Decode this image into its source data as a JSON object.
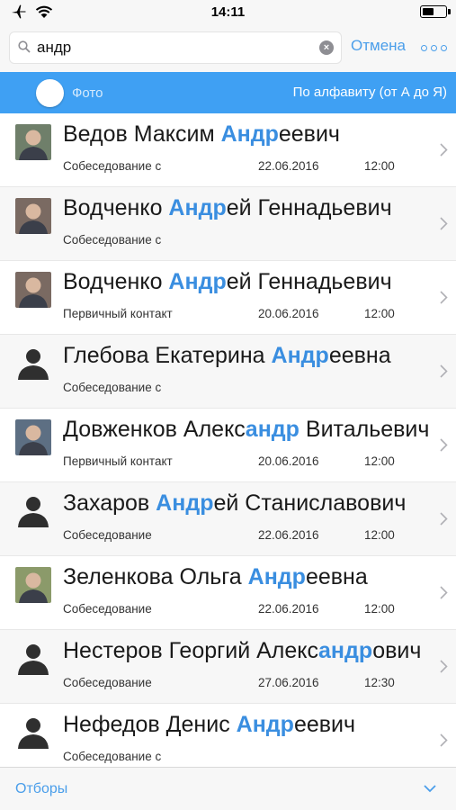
{
  "status_bar": {
    "time": "14:11",
    "icons": [
      "airplane-icon",
      "wifi-icon",
      "battery-icon"
    ]
  },
  "search": {
    "value": "андр",
    "placeholder": "",
    "cancel_label": "Отмена"
  },
  "filter_bar": {
    "photo_label": "Фото",
    "sort_label": "По алфавиту (от А до Я)"
  },
  "contacts": [
    {
      "name_pre": "Ведов Максим ",
      "name_hl": "Андр",
      "name_post": "еевич",
      "stage": "Собеседование с",
      "date": "22.06.2016",
      "time": "12:00",
      "avatar": "photo",
      "avatar_bg": "#6f7f6a"
    },
    {
      "name_pre": "Водченко ",
      "name_hl": "Андр",
      "name_post": "ей Геннадьевич",
      "stage": "Собеседование с",
      "date": "",
      "time": "",
      "avatar": "photo",
      "avatar_bg": "#7a6a62"
    },
    {
      "name_pre": "Водченко ",
      "name_hl": "Андр",
      "name_post": "ей Геннадьевич",
      "stage": "Первичный контакт",
      "date": "20.06.2016",
      "time": "12:00",
      "avatar": "photo",
      "avatar_bg": "#7a6a62"
    },
    {
      "name_pre": "Глебова Екатерина ",
      "name_hl": "Андр",
      "name_post": "еевна",
      "stage": "Собеседование с",
      "date": "",
      "time": "",
      "avatar": "silhouette",
      "avatar_bg": ""
    },
    {
      "name_pre": "Довженков Алекс",
      "name_hl": "андр",
      "name_post": " Витальевич",
      "stage": "Первичный контакт",
      "date": "20.06.2016",
      "time": "12:00",
      "avatar": "photo",
      "avatar_bg": "#5d6f83"
    },
    {
      "name_pre": "Захаров ",
      "name_hl": "Андр",
      "name_post": "ей Станиславович",
      "stage": "Собеседование",
      "date": "22.06.2016",
      "time": "12:00",
      "avatar": "silhouette",
      "avatar_bg": ""
    },
    {
      "name_pre": "Зеленкова Ольга ",
      "name_hl": "Андр",
      "name_post": "еевна",
      "stage": "Собеседование",
      "date": "22.06.2016",
      "time": "12:00",
      "avatar": "photo",
      "avatar_bg": "#8b9a6a"
    },
    {
      "name_pre": "Нестеров Георгий Алекс",
      "name_hl": "андр",
      "name_post": "ович",
      "stage": "Собеседование",
      "date": "27.06.2016",
      "time": "12:30",
      "avatar": "silhouette",
      "avatar_bg": ""
    },
    {
      "name_pre": "Нефедов Денис ",
      "name_hl": "Андр",
      "name_post": "еевич",
      "stage": "Собеседование с",
      "date": "",
      "time": "",
      "avatar": "silhouette",
      "avatar_bg": ""
    }
  ],
  "bottom_bar": {
    "filters_label": "Отборы"
  },
  "colors": {
    "accent": "#4a9eea",
    "filter_bar": "#3fa0f3",
    "highlight": "#3a8ee0"
  }
}
